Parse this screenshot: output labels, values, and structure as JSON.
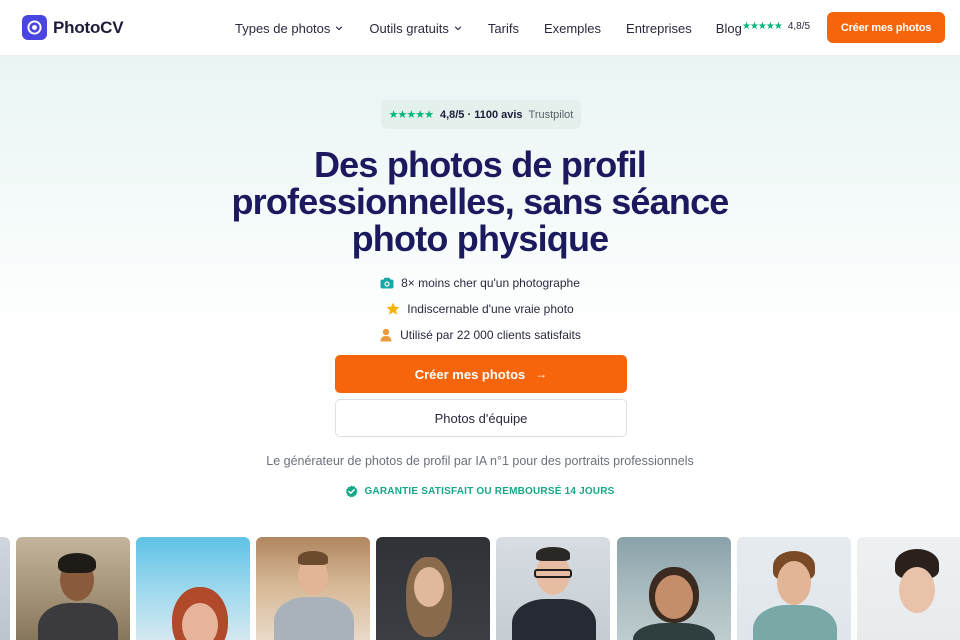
{
  "nav": {
    "brand": "PhotoCV",
    "menu": [
      {
        "label": "Types de photos",
        "has_dropdown": true
      },
      {
        "label": "Outils gratuits",
        "has_dropdown": true
      },
      {
        "label": "Tarifs",
        "has_dropdown": false
      },
      {
        "label": "Exemples",
        "has_dropdown": false
      },
      {
        "label": "Entreprises",
        "has_dropdown": false
      },
      {
        "label": "Blog",
        "has_dropdown": false
      }
    ],
    "rating_stars": "★★★★★",
    "rating_value": "4,8/5",
    "cta_label": "Créer mes photos"
  },
  "hero": {
    "trustpilot": {
      "stars": "★★★★★",
      "score": "4,8/5 · 1100 avis",
      "name": "Trustpilot"
    },
    "headline": "Des photos de profil professionnelles, sans séance photo physique",
    "features": [
      {
        "icon": "camera-icon",
        "text": "8× moins cher qu'un photographe"
      },
      {
        "icon": "star-icon",
        "text": "Indiscernable d'une vraie photo"
      },
      {
        "icon": "person-icon",
        "text": "Utilisé par 22 000 clients satisfaits"
      }
    ],
    "primary_button": "Créer mes photos",
    "primary_arrow": "→",
    "secondary_button": "Photos d'équipe",
    "subtitle": "Le générateur de photos de profil par IA n°1 pour des portraits professionnels",
    "guarantee": "GARANTIE SATISFAIT OU REMBOURSÉ 14 JOURS"
  },
  "colors": {
    "accent": "#f6650c",
    "brand": "#4a45e0",
    "headline": "#1b1a5e",
    "trustpilot_green": "#00b67a",
    "guarantee_green": "#17a888"
  }
}
